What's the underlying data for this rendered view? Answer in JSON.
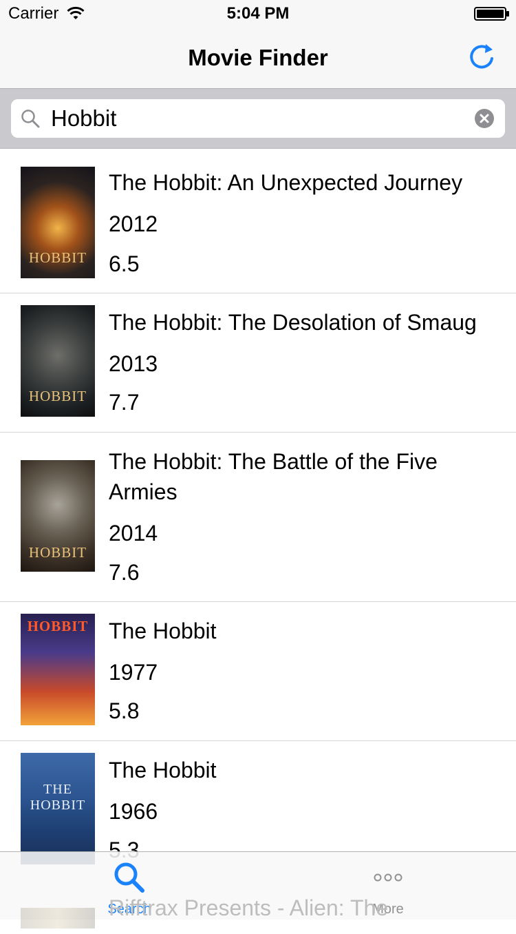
{
  "status_bar": {
    "carrier": "Carrier",
    "time": "5:04 PM",
    "wifi_icon": "wifi-icon",
    "battery_icon": "battery-icon"
  },
  "nav_bar": {
    "title": "Movie Finder",
    "refresh_icon": "refresh-icon"
  },
  "search": {
    "value": "Hobbit",
    "search_icon": "search-icon",
    "clear_icon": "clear-icon"
  },
  "movies": [
    {
      "title": "The Hobbit: An Unexpected Journey",
      "year": "2012",
      "rating": "6.5",
      "poster_caption": "HOBBIT"
    },
    {
      "title": "The Hobbit: The Desolation of Smaug",
      "year": "2013",
      "rating": "7.7",
      "poster_caption": "HOBBIT"
    },
    {
      "title": "The Hobbit: The Battle of the Five Armies",
      "year": "2014",
      "rating": "7.6",
      "poster_caption": "HOBBIT"
    },
    {
      "title": "The Hobbit",
      "year": "1977",
      "rating": "5.8",
      "poster_caption": "HOBBIT"
    },
    {
      "title": "The Hobbit",
      "year": "1966",
      "rating": "5.3",
      "poster_caption": "THE HOBBIT"
    },
    {
      "title": "Rifftrax Presents - Alien: The",
      "year": "",
      "rating": "",
      "poster_caption": ""
    }
  ],
  "tab_bar": {
    "tabs": [
      {
        "label": "Search",
        "icon": "search-icon",
        "active": true,
        "color": "#1a82fb"
      },
      {
        "label": "More",
        "icon": "more-icon",
        "active": false,
        "color": "#929292"
      }
    ]
  },
  "colors": {
    "accent": "#1a82fb",
    "bar_background": "#f7f7f7",
    "search_bar_background": "#c9c9ce",
    "separator": "#d4d4d6"
  }
}
